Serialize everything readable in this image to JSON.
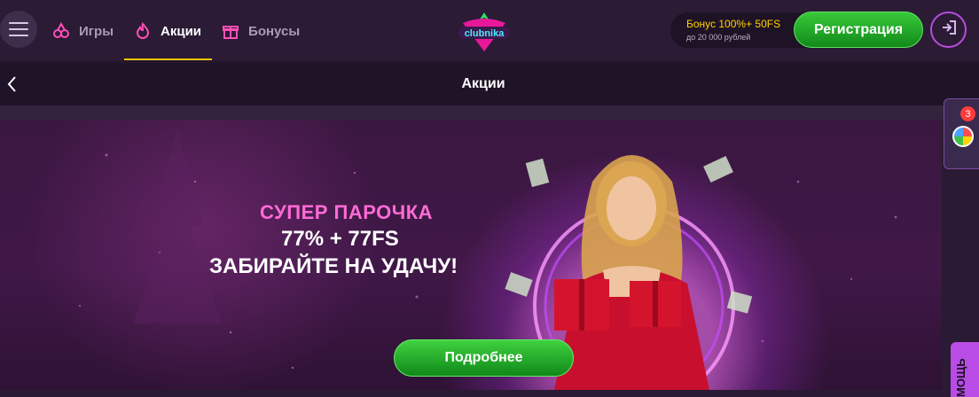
{
  "header": {
    "nav": [
      {
        "label": "Игры",
        "icon": "cherries-icon"
      },
      {
        "label": "Акции",
        "icon": "flame-icon",
        "active": true
      },
      {
        "label": "Бонусы",
        "icon": "gift-icon"
      }
    ],
    "logo_text": "clubnika",
    "bonus": {
      "main": "Бонус 100%+ 50FS",
      "sub": "до 20 000 рублей"
    },
    "register_label": "Регистрация"
  },
  "subbar": {
    "title": "Акции"
  },
  "banner": {
    "line1": "СУПЕР ПАРОЧКА",
    "line2": "77% + 77FS",
    "line3": "ЗАБИРАЙТЕ НА УДАЧУ!",
    "button_label": "Подробнее"
  },
  "side_widget": {
    "badge_count": "3",
    "icon": "fortune-wheel-icon"
  },
  "help_tab": {
    "label": "МОЩЬ"
  },
  "colors": {
    "accent_green": "#1fae2a",
    "accent_pink": "#ff6bd6",
    "accent_yellow": "#ffd400",
    "bg": "#2b1b35"
  }
}
